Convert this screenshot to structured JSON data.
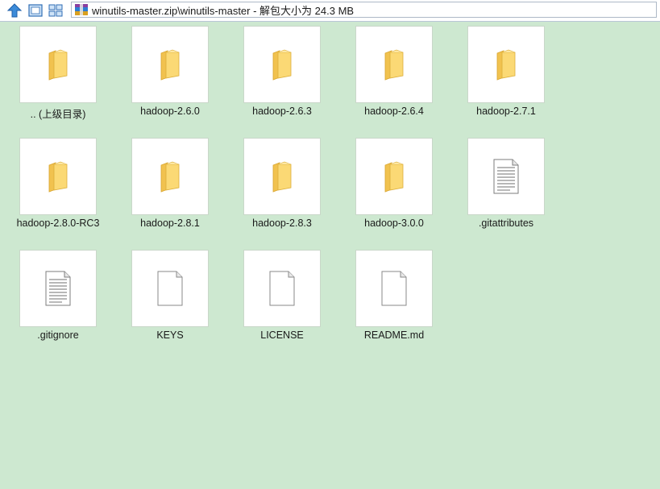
{
  "toolbar": {
    "address": "winutils-master.zip\\winutils-master - 解包大小为 24.3 MB"
  },
  "items": [
    {
      "label": ".. (上级目录)",
      "icon": "folder-icon"
    },
    {
      "label": "hadoop-2.6.0",
      "icon": "folder-icon"
    },
    {
      "label": "hadoop-2.6.3",
      "icon": "folder-icon"
    },
    {
      "label": "hadoop-2.6.4",
      "icon": "folder-icon"
    },
    {
      "label": "hadoop-2.7.1",
      "icon": "folder-icon"
    },
    {
      "label": "hadoop-2.8.0-RC3",
      "icon": "folder-icon"
    },
    {
      "label": "hadoop-2.8.1",
      "icon": "folder-icon"
    },
    {
      "label": "hadoop-2.8.3",
      "icon": "folder-icon"
    },
    {
      "label": "hadoop-3.0.0",
      "icon": "folder-icon"
    },
    {
      "label": ".gitattributes",
      "icon": "text-file-icon"
    },
    {
      "label": ".gitignore",
      "icon": "text-file-icon"
    },
    {
      "label": "KEYS",
      "icon": "blank-file-icon"
    },
    {
      "label": "LICENSE",
      "icon": "blank-file-icon"
    },
    {
      "label": "README.md",
      "icon": "blank-file-icon"
    }
  ]
}
